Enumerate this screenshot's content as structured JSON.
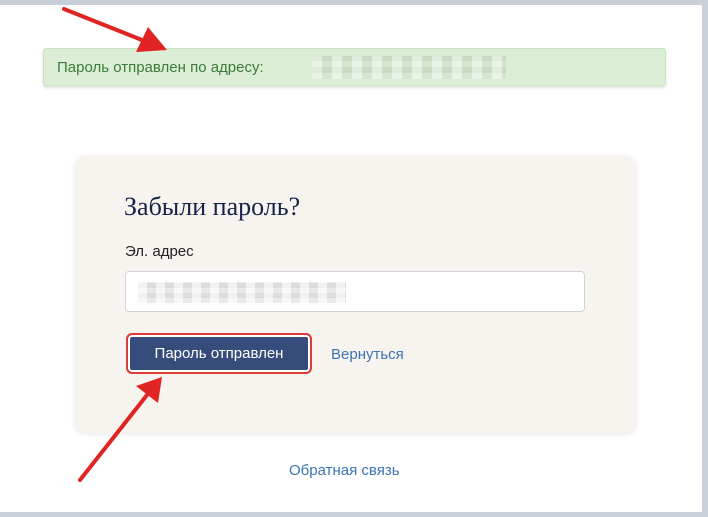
{
  "alert": {
    "message": "Пароль отправлен по адресу:",
    "status_color": "#3c7a3a"
  },
  "reset_form": {
    "title": "Забыли пароль?",
    "email_label": "Эл. адрес",
    "submit_label": "Пароль отправлен",
    "back_label": "Вернуться",
    "button_color": "#364d7c"
  },
  "footer": {
    "feedback_label": "Обратная связь"
  },
  "annotation": {
    "arrow_color": "#e02424",
    "highlight_color": "#e03a3a"
  }
}
